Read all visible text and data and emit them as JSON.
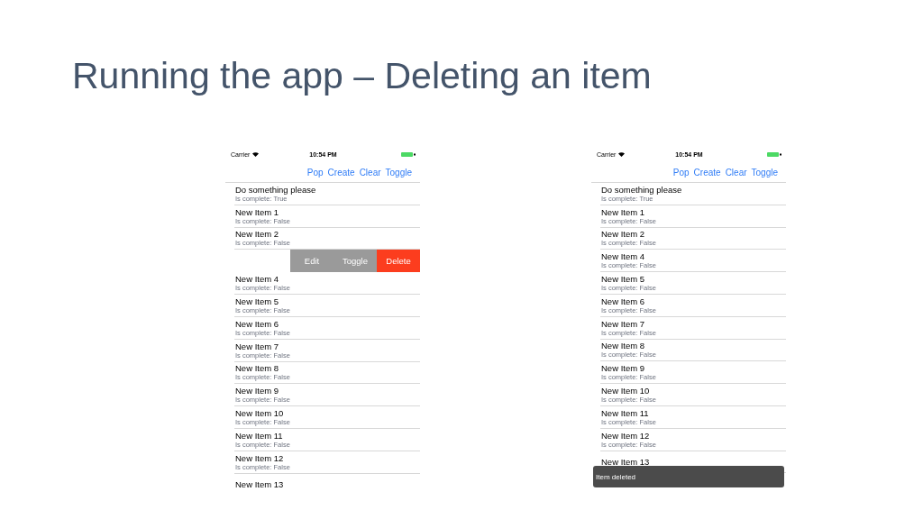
{
  "slide_title": "Running the app – Deleting an item",
  "phones": [
    {
      "status": {
        "carrier": "Carrier",
        "time": "10:54 PM"
      },
      "nav_buttons": [
        "Pop",
        "Create",
        "Clear",
        "Toggle"
      ],
      "rows": [
        {
          "kind": "item",
          "title": "Do something please",
          "subtitle": "Is complete: True"
        },
        {
          "kind": "item",
          "title": "New Item 1",
          "subtitle": "Is complete: False"
        },
        {
          "kind": "item",
          "title": "New Item 2",
          "subtitle": "Is complete: False"
        },
        {
          "kind": "swiped",
          "actions": [
            {
              "label": "Edit",
              "kind": "neutral"
            },
            {
              "label": "Toggle",
              "kind": "neutral"
            },
            {
              "label": "Delete",
              "kind": "destructive"
            }
          ]
        },
        {
          "kind": "item",
          "title": "New Item 4",
          "subtitle": "Is complete: False"
        },
        {
          "kind": "item",
          "title": "New Item 5",
          "subtitle": "Is complete: False"
        },
        {
          "kind": "item",
          "title": "New Item 6",
          "subtitle": "Is complete: False"
        },
        {
          "kind": "item",
          "title": "New Item 7",
          "subtitle": "Is complete: False"
        },
        {
          "kind": "item",
          "title": "New Item 8",
          "subtitle": "Is complete: False"
        },
        {
          "kind": "item",
          "title": "New Item 9",
          "subtitle": "Is complete: False"
        },
        {
          "kind": "item",
          "title": "New Item 10",
          "subtitle": "Is complete: False"
        },
        {
          "kind": "item",
          "title": "New Item 11",
          "subtitle": "Is complete: False"
        },
        {
          "kind": "item",
          "title": "New Item 12",
          "subtitle": "Is complete: False"
        },
        {
          "kind": "item",
          "title": "New Item 13"
        }
      ]
    },
    {
      "status": {
        "carrier": "Carrier",
        "time": "10:54 PM"
      },
      "nav_buttons": [
        "Pop",
        "Create",
        "Clear",
        "Toggle"
      ],
      "rows": [
        {
          "kind": "item",
          "title": "Do something please",
          "subtitle": "Is complete: True"
        },
        {
          "kind": "item",
          "title": "New Item 1",
          "subtitle": "Is complete: False"
        },
        {
          "kind": "item",
          "title": "New Item 2",
          "subtitle": "Is complete: False"
        },
        {
          "kind": "item",
          "title": "New Item 4",
          "subtitle": "Is complete: False"
        },
        {
          "kind": "item",
          "title": "New Item 5",
          "subtitle": "Is complete: False"
        },
        {
          "kind": "item",
          "title": "New Item 6",
          "subtitle": "Is complete: False"
        },
        {
          "kind": "item",
          "title": "New Item 7",
          "subtitle": "Is complete: False"
        },
        {
          "kind": "item",
          "title": "New Item 8",
          "subtitle": "Is complete: False"
        },
        {
          "kind": "item",
          "title": "New Item 9",
          "subtitle": "Is complete: False"
        },
        {
          "kind": "item",
          "title": "New Item 10",
          "subtitle": "Is complete: False"
        },
        {
          "kind": "item",
          "title": "New Item 11",
          "subtitle": "Is complete: False"
        },
        {
          "kind": "item",
          "title": "New Item 12",
          "subtitle": "Is complete: False"
        },
        {
          "kind": "item",
          "title": "New Item 13"
        }
      ],
      "toast": "Item deleted"
    }
  ]
}
